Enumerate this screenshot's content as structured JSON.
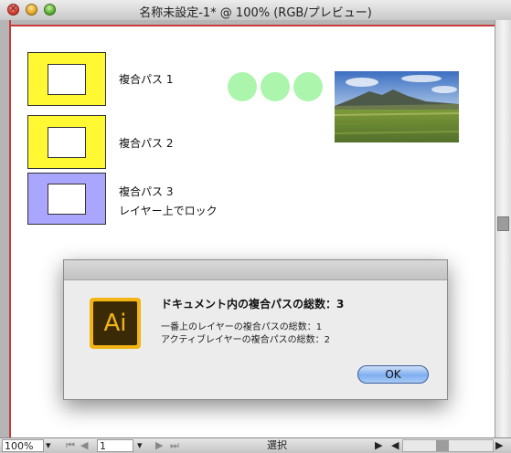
{
  "window": {
    "title": "名称未設定-1* @ 100% (RGB/プレビュー)",
    "close_glyph": "×"
  },
  "artboard": {
    "items": [
      {
        "label": "複合パス 1",
        "fill": "#fff833"
      },
      {
        "label": "複合パス 2",
        "fill": "#fff833"
      },
      {
        "label": "複合パス 3",
        "sublabel": "レイヤー上でロック",
        "fill": "#aaa5fd"
      }
    ],
    "circle_color": "#acf5ad"
  },
  "dialog": {
    "app_icon_text": "Ai",
    "heading": "ドキュメント内の複合パスの総数：3",
    "line1": "一番上のレイヤーの複合パスの総数：1",
    "line2": "アクティブレイヤーの複合パスの総数：2",
    "ok_label": "OK"
  },
  "statusbar": {
    "zoom": "100%",
    "page": "1",
    "status": "選択"
  }
}
